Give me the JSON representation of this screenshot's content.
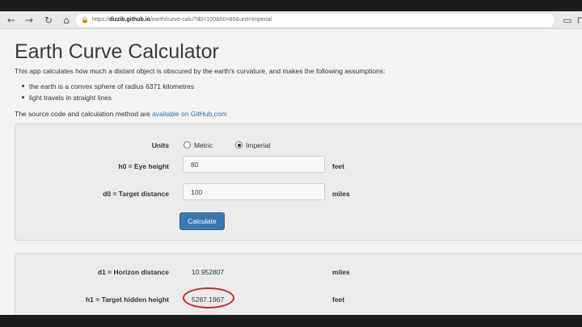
{
  "browser": {
    "url_prefix": "https://",
    "url_host": "dizzib.github.io",
    "url_path": "/earth/curve-calc/?d0=100&h0=80&unit=imperial"
  },
  "header": {
    "title": "Earth Curve Calculator",
    "intro": "This app calculates how much a distant object is obscured by the earth's curvature, and makes the following assumptions:",
    "assumptions": [
      "the earth is a convex sphere of radius 6371 kilometres",
      "light travels in straight lines"
    ],
    "source_prefix": "The source code and calculation method are ",
    "source_link": "available on GitHub.com"
  },
  "form": {
    "units_label": "Units",
    "units_options": [
      "Metric",
      "Imperial"
    ],
    "units_selected": "Imperial",
    "h0_label": "h0 = Eye height",
    "h0_value": "80",
    "h0_unit": "feet",
    "d0_label": "d0 = Target distance",
    "d0_value": "100",
    "d0_unit": "miles",
    "calculate_label": "Calculate"
  },
  "results": {
    "d1_label": "d1 = Horizon distance",
    "d1_value": "10.952807",
    "d1_unit": "miles",
    "h1_label": "h1 = Target hidden height",
    "h1_value": "5287.1967",
    "h1_unit": "feet"
  },
  "colors": {
    "accent": "#3b79b3",
    "link": "#2e6ea8",
    "highlight": "#c8282a"
  }
}
